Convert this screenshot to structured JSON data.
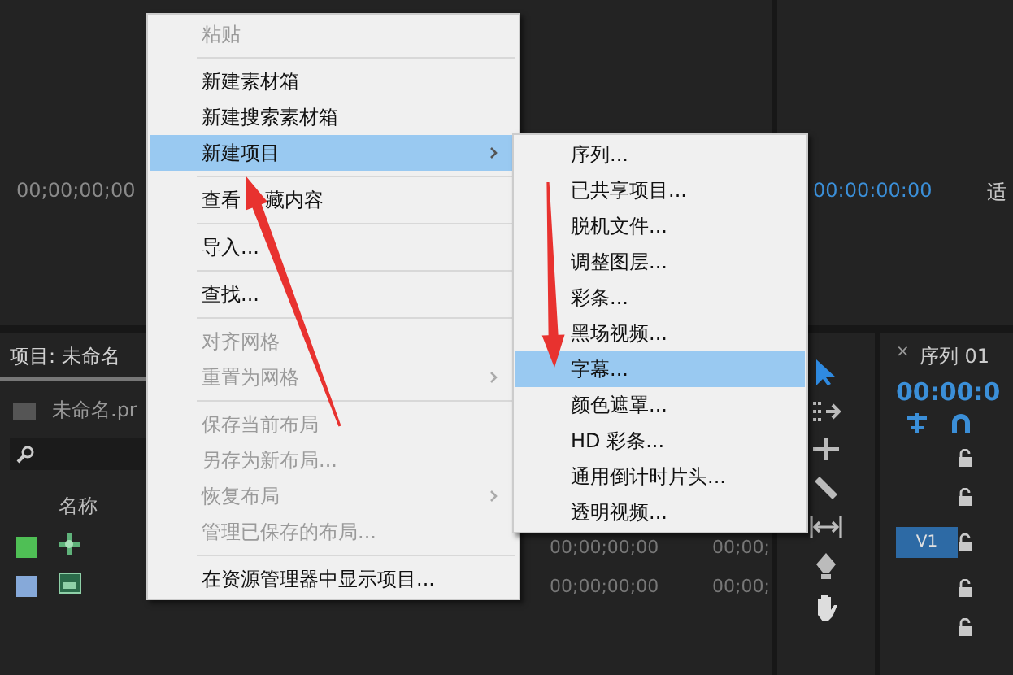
{
  "source_monitor": {
    "timecode": "00;00;00;00"
  },
  "program_monitor": {
    "timecode": "00:00:00:00",
    "label": "适"
  },
  "project_panel": {
    "tab": "项目: 未命名",
    "bin_name": "未命名.pr",
    "name_column": "名称",
    "rows": [
      {
        "kind": "sequence",
        "color": "#4fbf55",
        "media_start": "00;00;00;00",
        "column_3": "00;00;"
      },
      {
        "kind": "clip",
        "color": "#86a9d9",
        "media_start": "00;00;00;00",
        "column_3": "00;00;"
      }
    ]
  },
  "timeline": {
    "close": "×",
    "tab": "序列 01",
    "timecode": "00:00:0",
    "track_label": "V1"
  },
  "context_menu": {
    "items": [
      {
        "kind": "item",
        "label": "粘贴",
        "disabled": true,
        "selected": false,
        "has_submenu": false
      },
      {
        "kind": "separator"
      },
      {
        "kind": "item",
        "label": "新建素材箱",
        "disabled": false,
        "selected": false,
        "has_submenu": false
      },
      {
        "kind": "item",
        "label": "新建搜索素材箱",
        "disabled": false,
        "selected": false,
        "has_submenu": false
      },
      {
        "kind": "item",
        "label": "新建项目",
        "disabled": false,
        "selected": true,
        "has_submenu": true
      },
      {
        "kind": "separator"
      },
      {
        "kind": "item",
        "label_parts": [
          "查看",
          "藏内容"
        ],
        "disabled": false,
        "selected": false,
        "has_submenu": false
      },
      {
        "kind": "separator"
      },
      {
        "kind": "item",
        "label": "导入...",
        "disabled": false,
        "selected": false,
        "has_submenu": false
      },
      {
        "kind": "separator"
      },
      {
        "kind": "item",
        "label": "查找...",
        "disabled": false,
        "selected": false,
        "has_submenu": false
      },
      {
        "kind": "separator"
      },
      {
        "kind": "item",
        "label": "对齐网格",
        "disabled": true,
        "selected": false,
        "has_submenu": false
      },
      {
        "kind": "item",
        "label": "重置为网格",
        "disabled": true,
        "selected": false,
        "has_submenu": true
      },
      {
        "kind": "separator"
      },
      {
        "kind": "item",
        "label": "保存当前布局",
        "disabled": true,
        "selected": false,
        "has_submenu": false
      },
      {
        "kind": "item",
        "label": "另存为新布局...",
        "disabled": true,
        "selected": false,
        "has_submenu": false
      },
      {
        "kind": "item",
        "label": "恢复布局",
        "disabled": true,
        "selected": false,
        "has_submenu": true
      },
      {
        "kind": "item",
        "label": "管理已保存的布局...",
        "disabled": true,
        "selected": false,
        "has_submenu": false
      },
      {
        "kind": "separator"
      },
      {
        "kind": "item",
        "label": "在资源管理器中显示项目...",
        "disabled": false,
        "selected": false,
        "has_submenu": false
      }
    ]
  },
  "submenu": {
    "items": [
      {
        "label": "序列...",
        "selected": false
      },
      {
        "label": "已共享项目...",
        "selected": false
      },
      {
        "label": "脱机文件...",
        "selected": false
      },
      {
        "label": "调整图层...",
        "selected": false
      },
      {
        "label": "彩条...",
        "selected": false
      },
      {
        "label": "黑场视频...",
        "selected": false
      },
      {
        "label": "字幕...",
        "selected": true
      },
      {
        "label": "颜色遮罩...",
        "selected": false
      },
      {
        "label": "HD 彩条...",
        "selected": false
      },
      {
        "label": "通用倒计时片头...",
        "selected": false
      },
      {
        "label": "透明视频...",
        "selected": false
      }
    ]
  }
}
